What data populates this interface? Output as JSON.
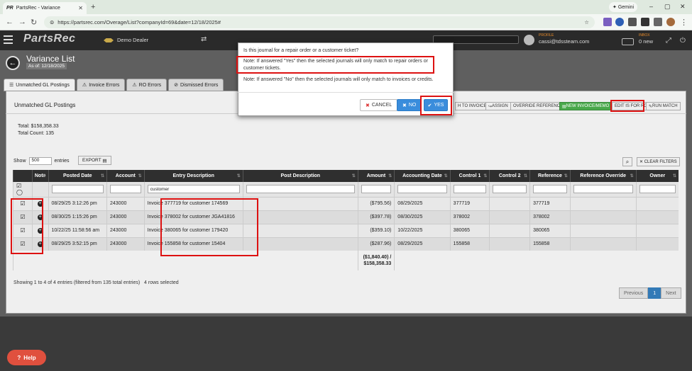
{
  "browser": {
    "tab_title": "PartsRec - Variance",
    "url": "https://partsrec.com/Overage/List?companyId=69&date=12/18/2025#",
    "gemini_label": "Gemini"
  },
  "header": {
    "logo": "PartsRec",
    "dealer": "Demo Dealer",
    "profile_label": "PROFILE",
    "profile_name": "cassi@tdssteam.com",
    "inbox_label": "INBOX",
    "inbox_count": "0 new"
  },
  "page": {
    "title": "Variance List",
    "as_of": "As of: 12/18/2025"
  },
  "tabs": [
    {
      "label": "Unmatched GL Postings",
      "icon": "list-icon"
    },
    {
      "label": "Invoice Errors",
      "icon": "warning-icon"
    },
    {
      "label": "RO Errors",
      "icon": "warning-icon"
    },
    {
      "label": "Dismissed Errors",
      "icon": "circle-icon"
    }
  ],
  "panel": {
    "title": "Unmatched GL Postings",
    "total": "Total: $158,358.33",
    "count": "Total Count: 135",
    "show_label": "Show",
    "entries_value": "500",
    "entries_label": "entries",
    "export_label": "EXPORT",
    "clear_filters": "CLEAR FILTERS"
  },
  "actions": [
    {
      "label": "H TO INVOICE",
      "icon": "link-icon"
    },
    {
      "label": "ASSIGN",
      "icon": "share-icon"
    },
    {
      "label": "OVERRIDE REFERENCE",
      "icon": ""
    },
    {
      "label": "NEW INVOICE/MEMO",
      "icon": "doc-icon"
    },
    {
      "label": "EDIT IS FOR RO",
      "icon": ""
    },
    {
      "label": "RUN MATCH",
      "icon": "wrench-icon"
    }
  ],
  "table": {
    "headers": [
      "",
      "Note",
      "Posted Date",
      "Account",
      "Entry Description",
      "Post Description",
      "Amount",
      "Accounting Date",
      "Control 1",
      "Control 2",
      "Reference",
      "Reference Override",
      "Owner"
    ],
    "entry_filter": "customer",
    "rows": [
      {
        "posted": "08/29/25 3:12:26 pm",
        "account": "243000",
        "desc": "Invoice 377719 for customer 174569",
        "amount": "($795.56)",
        "acct_date": "08/29/2025",
        "control1": "377719",
        "reference": "377719"
      },
      {
        "posted": "08/30/25 1:15:26 pm",
        "account": "243000",
        "desc": "Invoice 378002 for customer JGA41816",
        "amount": "($397.78)",
        "acct_date": "08/30/2025",
        "control1": "378002",
        "reference": "378002"
      },
      {
        "posted": "10/22/25 11:58:56 am",
        "account": "243000",
        "desc": "Invoice 380065 for customer 179420",
        "amount": "($359.10)",
        "acct_date": "10/22/2025",
        "control1": "380065",
        "reference": "380065"
      },
      {
        "posted": "08/29/25 3:52:15 pm",
        "account": "243000",
        "desc": "Invoice 155858 for customer 15404",
        "amount": "($287.96)",
        "acct_date": "08/29/2025",
        "control1": "155858",
        "reference": "155858"
      }
    ],
    "footer_amount_1": "($1,840.40) /",
    "footer_amount_2": "$158,358.33"
  },
  "status": {
    "showing": "Showing 1 to 4 of 4 entries (filtered from 135 total entries)",
    "selected": "4 rows selected"
  },
  "pager": {
    "prev": "Previous",
    "page": "1",
    "next": "Next"
  },
  "help_label": "Help",
  "modal": {
    "question": "Is this journal for a repair order or a customer ticket?",
    "note_yes": "Note: If answered \"Yes\" then the selected journals will only match to repair orders or customer tickets.",
    "note_no": "Note: If answered \"No\" then the selected journals will only match to invoices or credits.",
    "cancel": "CANCEL",
    "no": "NO",
    "yes": "YES"
  }
}
